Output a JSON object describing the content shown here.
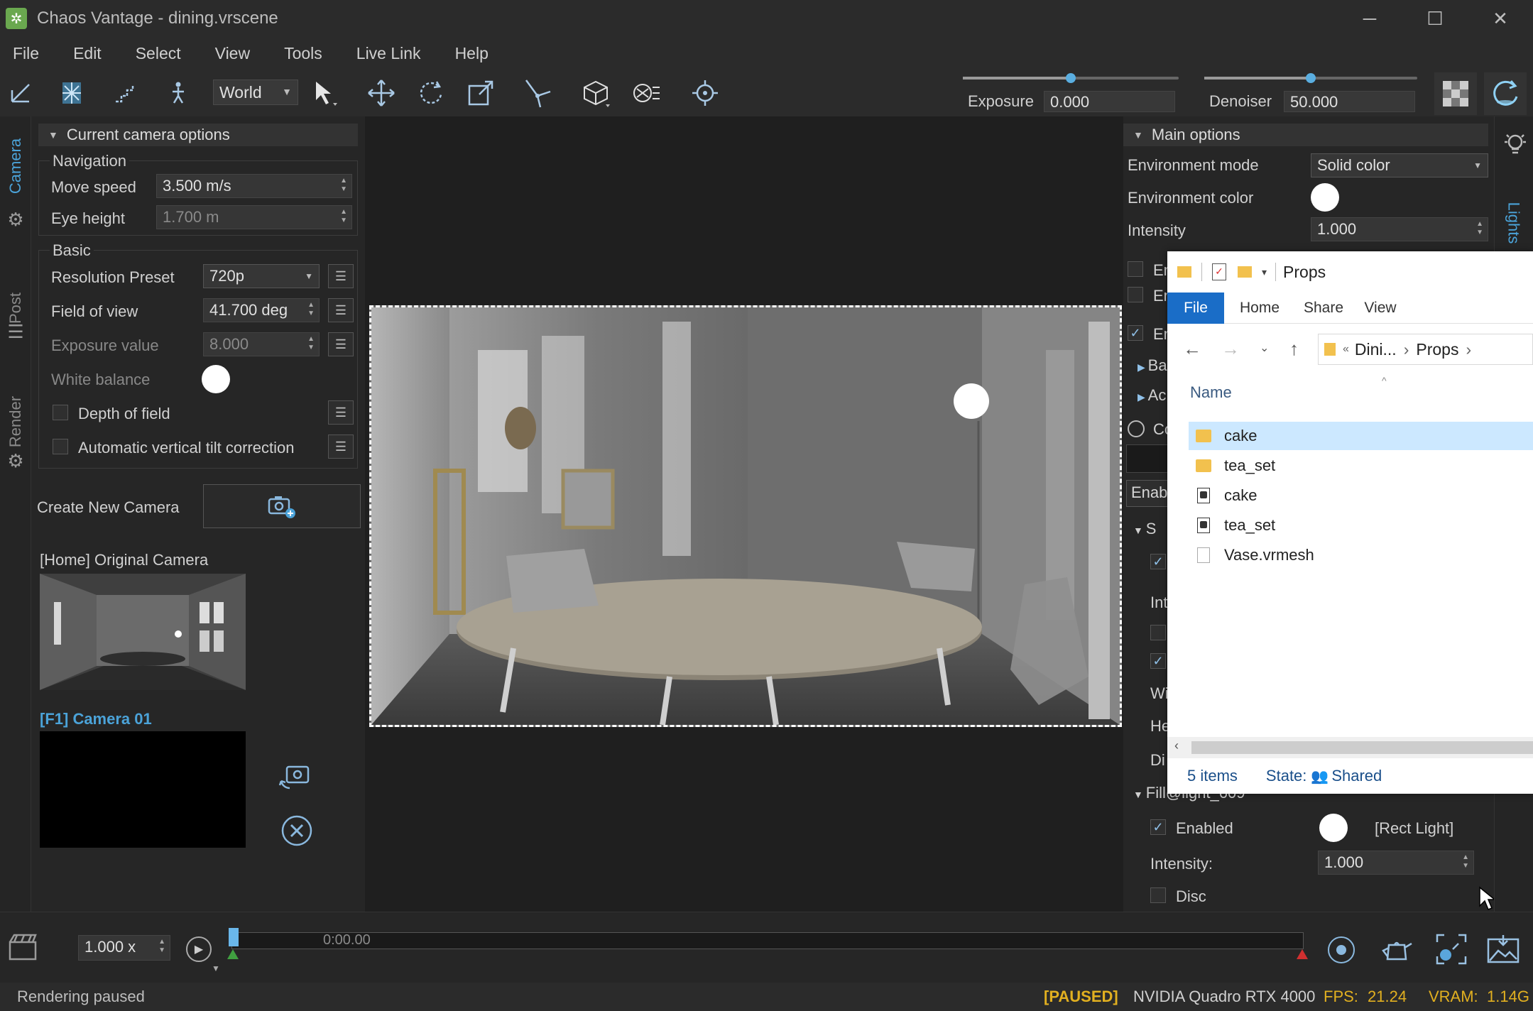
{
  "window": {
    "title": "Chaos Vantage - dining.vrscene",
    "minimize": "─",
    "maximize": "☐",
    "close": "✕"
  },
  "menu": [
    "File",
    "Edit",
    "Select",
    "View",
    "Tools",
    "Live Link",
    "Help"
  ],
  "toolbar": {
    "space_select": "World",
    "exposure_label": "Exposure",
    "exposure_value": "0.000",
    "exposure_level": 0.5,
    "denoiser_label": "Denoiser",
    "denoiser_value": "50.000",
    "denoiser_level": 0.5,
    "icons": [
      "axis-icon",
      "snowflake-light-icon",
      "stairs-icon",
      "walk-icon",
      "select-arrow-icon",
      "move-icon",
      "rotate-icon",
      "scale-icon",
      "snap-icon",
      "object-icon",
      "gear-object-icon",
      "target-icon"
    ]
  },
  "left_tabs": [
    "Camera",
    "Post",
    "Render"
  ],
  "right_tabs": [
    "Lights"
  ],
  "camera_panel": {
    "header": "Current camera options",
    "navigation_title": "Navigation",
    "move_speed_label": "Move speed",
    "move_speed_value": "3.500 m/s",
    "eye_height_label": "Eye height",
    "eye_height_value": "1.700 m",
    "basic_title": "Basic",
    "resolution_label": "Resolution Preset",
    "resolution_value": "720p",
    "fov_label": "Field of view",
    "fov_value": "41.700 deg",
    "exposure_label": "Exposure value",
    "exposure_value": "8.000",
    "wb_label": "White balance",
    "dof_label": "Depth of field",
    "tilt_label": "Automatic vertical tilt correction",
    "create_camera_label": "Create New Camera",
    "cameras": [
      {
        "label": "[Home] Original Camera"
      },
      {
        "label": "[F1] Camera 01"
      }
    ]
  },
  "lights_panel": {
    "header": "Main options",
    "env_mode_label": "Environment mode",
    "env_mode_value": "Solid color",
    "env_color_label": "Environment color",
    "intensity_label": "Intensity",
    "intensity_value": "1.000",
    "partial_rows": [
      "En",
      "En",
      "En",
      "Ba",
      "Ac",
      "Co",
      "Enab",
      "S",
      "Int",
      "Wi",
      "He",
      "Di"
    ],
    "light_header": "Fill@light_609",
    "enabled_label": "Enabled",
    "light_type": "[Rect Light]",
    "light_intensity_label": "Intensity:",
    "light_intensity_value": "1.000",
    "disc_label": "Disc"
  },
  "explorer": {
    "title": "Props",
    "tabs": [
      "File",
      "Home",
      "Share",
      "View"
    ],
    "breadcrumb_parent": "Dini...",
    "breadcrumb_current": "Props",
    "column_name": "Name",
    "items": [
      {
        "name": "cake",
        "kind": "folder"
      },
      {
        "name": "tea_set",
        "kind": "folder"
      },
      {
        "name": "cake",
        "kind": "file"
      },
      {
        "name": "tea_set",
        "kind": "file"
      },
      {
        "name": "Vase.vrmesh",
        "kind": "blank"
      }
    ],
    "count": "5 items",
    "state_label": "State:",
    "state_value": "Shared"
  },
  "timeline": {
    "speed": "1.000 x",
    "time": "0:00.00"
  },
  "status": {
    "left": "Rendering paused",
    "paused": "[PAUSED]",
    "gpu": "NVIDIA Quadro RTX 4000",
    "fps_label": "FPS:",
    "fps_value": "21.24",
    "vram_label": "VRAM:",
    "vram_value": "1.14G"
  },
  "colors": {
    "accent": "#4ba3d9",
    "paused": "#e2b020",
    "background": "#1e1e1e"
  }
}
